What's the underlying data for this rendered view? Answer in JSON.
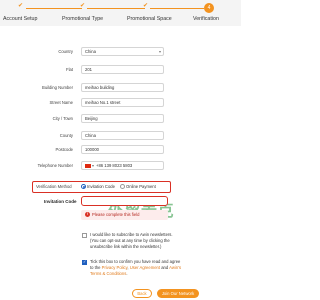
{
  "stepper": {
    "steps": [
      {
        "label": "Account Setup",
        "number": "1",
        "state": "done"
      },
      {
        "label": "Promotional Type",
        "number": "2",
        "state": "done"
      },
      {
        "label": "Promotional Space",
        "number": "3",
        "state": "done"
      },
      {
        "label": "Verification",
        "number": "4",
        "state": "active"
      }
    ],
    "accent_color": "#f39320"
  },
  "form": {
    "country": {
      "label": "Country",
      "value": "China"
    },
    "flat": {
      "label": "Flat",
      "value": "201"
    },
    "building_number": {
      "label": "Building Number",
      "value": "meihao building"
    },
    "street_name": {
      "label": "Street Name",
      "value": "meihao No.1 street"
    },
    "city": {
      "label": "City / Town",
      "value": "Beijing"
    },
    "county": {
      "label": "County",
      "value": "China"
    },
    "postcode": {
      "label": "Postcode",
      "value": "100000"
    },
    "telephone": {
      "label": "Telephone Number",
      "value": "+86 139 8023 5803"
    }
  },
  "verification": {
    "label": "Verification Method",
    "options": [
      "Invitation Code",
      "Online Payment"
    ],
    "selected": "Invitation Code"
  },
  "invitation": {
    "label": "Invitation Code",
    "value": "",
    "error": "Please complete this field"
  },
  "newsletter": {
    "checked": false,
    "text": "I would like to subscribe to Awin newsletters. (You can opt-out at any time by clicking the unsubscribe link within the newsletter.)"
  },
  "terms": {
    "checked": true,
    "prefix": "Tick this box to confirm you have read and agree to the",
    "privacy_policy": "Privacy Policy",
    "comma": ",",
    "user_agreement": "User Agreement",
    "and": "and",
    "awin_terms": "Awin's Terms & Conditions",
    "suffix": "."
  },
  "watermark": "外贸麦克",
  "buttons": {
    "back": "Back",
    "join": "Join Our Network"
  }
}
